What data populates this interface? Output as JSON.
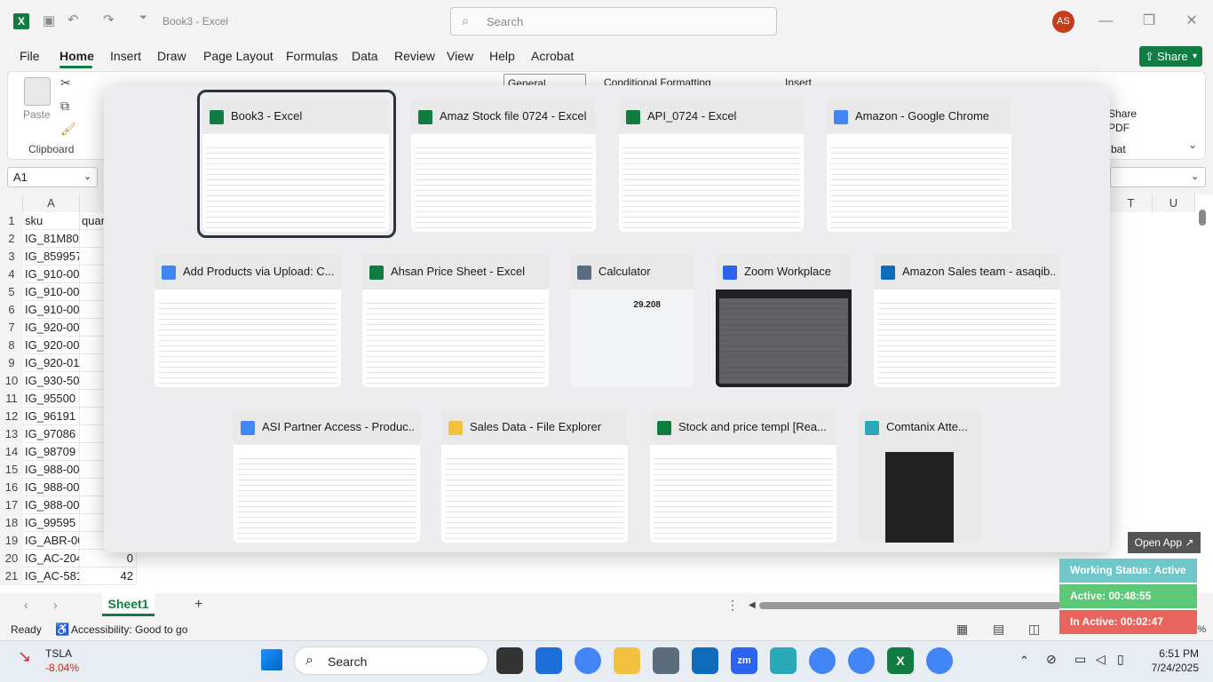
{
  "titlebar": {
    "doc_title": "Book3  -  Excel",
    "search_placeholder": "Search",
    "avatar_initials": "AS"
  },
  "menu": {
    "items": [
      "File",
      "Home",
      "Insert",
      "Draw",
      "Page Layout",
      "Formulas",
      "Data",
      "Review",
      "View",
      "Help",
      "Acrobat"
    ],
    "active": "Home",
    "share_label": "Share"
  },
  "ribbon": {
    "paste_label": "Paste",
    "clipboard_label": "Clipboard",
    "number_format": "General",
    "conditional_formatting": "Conditional Formatting",
    "insert_label": "Insert",
    "share_pdf_label": "Share\nPDF",
    "acrobat_label": "bat"
  },
  "formula_bar": {
    "name_box": "A1"
  },
  "grid": {
    "col_headers": [
      "A",
      "T",
      "U"
    ],
    "rows": [
      {
        "n": "1",
        "a": "sku",
        "b": "quan"
      },
      {
        "n": "2",
        "a": "IG_81M80",
        "b": ""
      },
      {
        "n": "3",
        "a": "IG_859957",
        "b": ""
      },
      {
        "n": "4",
        "a": "IG_910-00",
        "b": ""
      },
      {
        "n": "5",
        "a": "IG_910-00",
        "b": ""
      },
      {
        "n": "6",
        "a": "IG_910-00",
        "b": ""
      },
      {
        "n": "7",
        "a": "IG_920-00",
        "b": ""
      },
      {
        "n": "8",
        "a": "IG_920-00",
        "b": ""
      },
      {
        "n": "9",
        "a": "IG_920-01",
        "b": ""
      },
      {
        "n": "10",
        "a": "IG_930-50",
        "b": ""
      },
      {
        "n": "11",
        "a": "IG_95500",
        "b": ""
      },
      {
        "n": "12",
        "a": "IG_96191",
        "b": ""
      },
      {
        "n": "13",
        "a": "IG_97086",
        "b": ""
      },
      {
        "n": "14",
        "a": "IG_98709",
        "b": ""
      },
      {
        "n": "15",
        "a": "IG_988-00",
        "b": ""
      },
      {
        "n": "16",
        "a": "IG_988-00",
        "b": ""
      },
      {
        "n": "17",
        "a": "IG_988-00",
        "b": ""
      },
      {
        "n": "18",
        "a": "IG_99595",
        "b": ""
      },
      {
        "n": "19",
        "a": "IG_ABR-00",
        "b": ""
      },
      {
        "n": "20",
        "a": "IG_AC-204",
        "b": "0"
      },
      {
        "n": "21",
        "a": "IG_AC-581",
        "b": "42"
      }
    ]
  },
  "sheet_tab": "Sheet1",
  "status": {
    "ready": "Ready",
    "accessibility": "Accessibility: Good to go"
  },
  "switcher": {
    "cards": [
      {
        "title": "Book3 - Excel",
        "icon": "excel-icon",
        "color": "#107c41"
      },
      {
        "title": "Amaz Stock file 0724 - Excel",
        "icon": "excel-icon",
        "color": "#107c41"
      },
      {
        "title": "API_0724 - Excel",
        "icon": "excel-icon",
        "color": "#107c41"
      },
      {
        "title": "Amazon - Google Chrome",
        "icon": "chrome-icon",
        "color": "#4285f4"
      },
      {
        "title": "Add Products via Upload: C...",
        "icon": "chrome-icon",
        "color": "#4285f4"
      },
      {
        "title": "Ahsan Price Sheet - Excel",
        "icon": "excel-icon",
        "color": "#107c41"
      },
      {
        "title": "Calculator",
        "icon": "calculator-icon",
        "color": "#5a6b7c"
      },
      {
        "title": "Zoom Workplace",
        "icon": "zoom-icon",
        "color": "#2d63f1"
      },
      {
        "title": "Amazon Sales team - asaqib...",
        "icon": "outlook-icon",
        "color": "#0f6cbd"
      },
      {
        "title": "ASI Partner Access - Produc...",
        "icon": "chrome-icon",
        "color": "#4285f4"
      },
      {
        "title": "Sales Data - File Explorer",
        "icon": "folder-icon",
        "color": "#f2c140"
      },
      {
        "title": "Stock and price templ  [Rea...",
        "icon": "excel-icon",
        "color": "#107c41"
      },
      {
        "title": "Comtanix Atte...",
        "icon": "comtanix-icon",
        "color": "#2aa8b8"
      }
    ],
    "calculator_display": "29.208"
  },
  "widget": {
    "open_app": "Open App ↗",
    "working_status": "Working Status: Active",
    "active": "Active: 00:48:55",
    "inactive": "In Active: 00:02:47",
    "zoom_pct": "100%"
  },
  "taskbar": {
    "stock_symbol": "TSLA",
    "stock_change": "-8.04%",
    "search_label": "Search",
    "time": "6:51 PM",
    "date": "7/24/2025"
  },
  "colors": {
    "excel_green": "#107c41",
    "working_status": "#6fc7c9",
    "active": "#5cc878",
    "inactive": "#e8655e"
  }
}
